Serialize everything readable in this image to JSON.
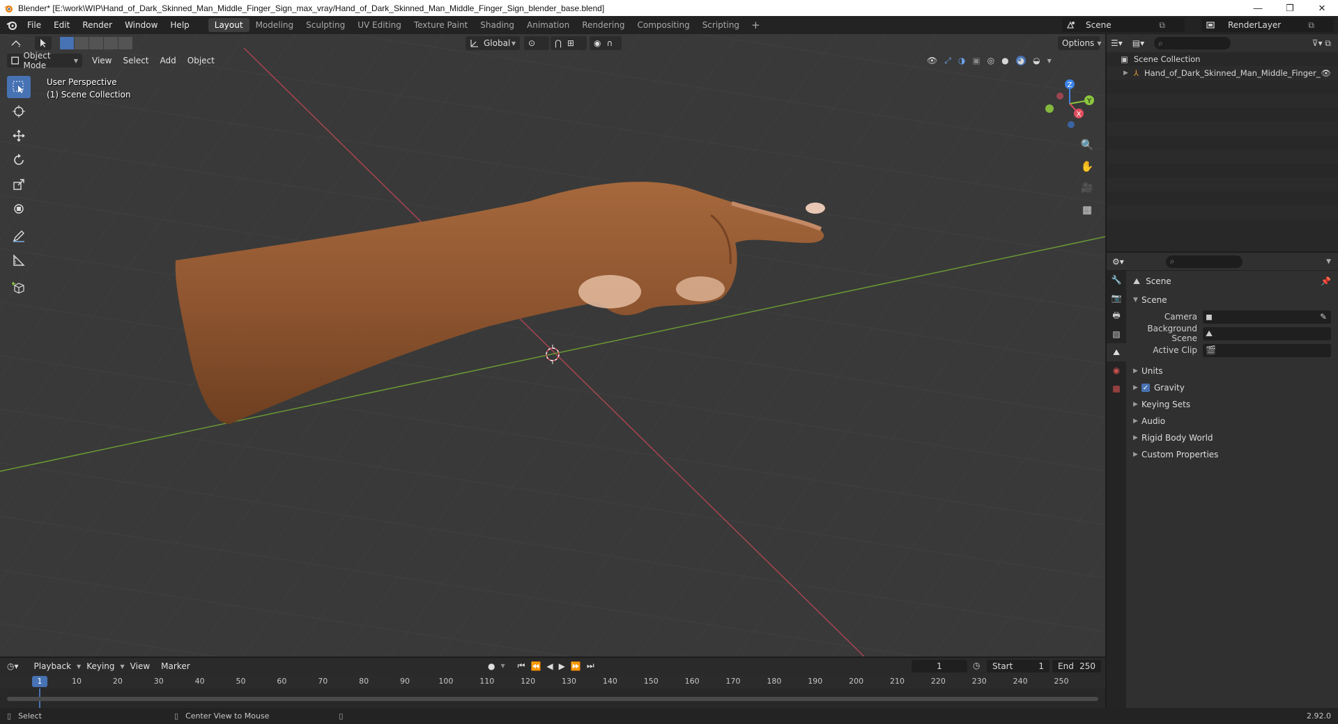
{
  "window": {
    "title": "Blender* [E:\\work\\WIP\\Hand_of_Dark_Skinned_Man_Middle_Finger_Sign_max_vray/Hand_of_Dark_Skinned_Man_Middle_Finger_Sign_blender_base.blend]",
    "minimize": "—",
    "restore": "❐",
    "close": "✕"
  },
  "menus": [
    "File",
    "Edit",
    "Render",
    "Window",
    "Help"
  ],
  "workspaces": [
    "Layout",
    "Modeling",
    "Sculpting",
    "UV Editing",
    "Texture Paint",
    "Shading",
    "Animation",
    "Rendering",
    "Compositing",
    "Scripting"
  ],
  "workspace_add": "+",
  "scene_name": "Scene",
  "view_layer": "RenderLayer",
  "viewport": {
    "mode": "Object Mode",
    "menus": [
      "View",
      "Select",
      "Add",
      "Object"
    ],
    "transform_orientation": "Global",
    "options": "Options",
    "info_line1": "User Perspective",
    "info_line2": "(1) Scene Collection",
    "gizmo_z": "Z",
    "gizmo_y": "Y",
    "gizmo_x": "X"
  },
  "outliner": {
    "root": "Scene Collection",
    "object": "Hand_of_Dark_Skinned_Man_Middle_Finger_"
  },
  "properties": {
    "context": "Scene",
    "section": "Scene",
    "camera_label": "Camera",
    "background_label": "Background Scene",
    "clip_label": "Active Clip",
    "panels": [
      "Units",
      "Gravity",
      "Keying Sets",
      "Audio",
      "Rigid Body World",
      "Custom Properties"
    ]
  },
  "timeline": {
    "menus": [
      "Playback",
      "Keying",
      "View",
      "Marker"
    ],
    "current_frame": "1",
    "start_label": "Start",
    "start": "1",
    "end_label": "End",
    "end": "250",
    "ticks": [
      "1",
      "10",
      "20",
      "30",
      "40",
      "50",
      "60",
      "70",
      "80",
      "90",
      "100",
      "110",
      "120",
      "130",
      "140",
      "150",
      "160",
      "170",
      "180",
      "190",
      "200",
      "210",
      "220",
      "230",
      "240",
      "250"
    ]
  },
  "status": {
    "select": "Select",
    "center": "Center View to Mouse",
    "version": "2.92.0"
  },
  "colors": {
    "accent": "#4772b3",
    "x_axis": "#e04f5f",
    "y_axis": "#8cc63e",
    "z_axis": "#3c82e8"
  }
}
